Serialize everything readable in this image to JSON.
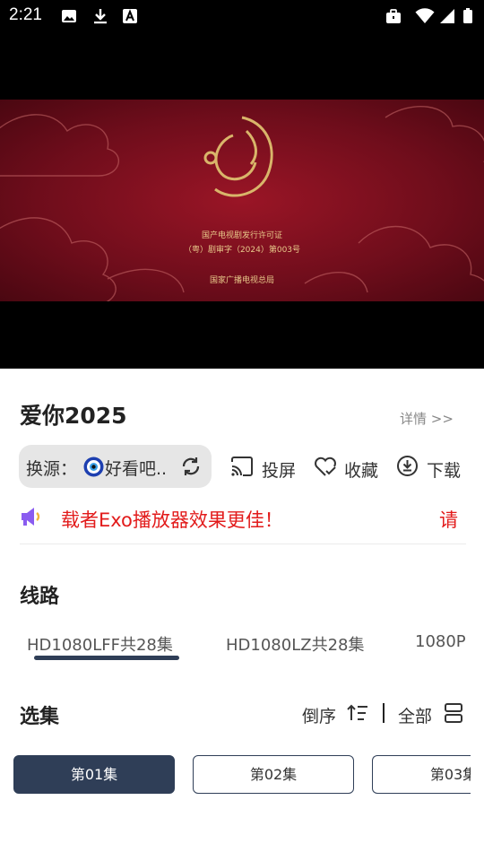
{
  "status_bar": {
    "time": "2:21"
  },
  "video": {
    "poster_lines": [
      "国产电视剧发行许可证",
      "（粤）剧审字（2024）第003号",
      "国家广播电视总局"
    ]
  },
  "title": "爱你2025",
  "details_link": "详情 >>",
  "source": {
    "label": "换源：",
    "value": "好看吧.."
  },
  "actions": {
    "cast": "投屏",
    "favorite": "收藏",
    "download": "下载"
  },
  "notice": {
    "text": "载者Exo播放器效果更佳！",
    "next": "请"
  },
  "routes": {
    "title": "线路",
    "items": [
      "HD1080LFF共28集",
      "HD1080LZ共28集",
      "1080P"
    ]
  },
  "episodes": {
    "title": "选集",
    "sort_label": "倒序",
    "all_label": "全部",
    "items": [
      "第01集",
      "第02集",
      "第03集"
    ]
  },
  "colors": {
    "accent": "#2f3e57",
    "notice": "#e21b1b"
  }
}
